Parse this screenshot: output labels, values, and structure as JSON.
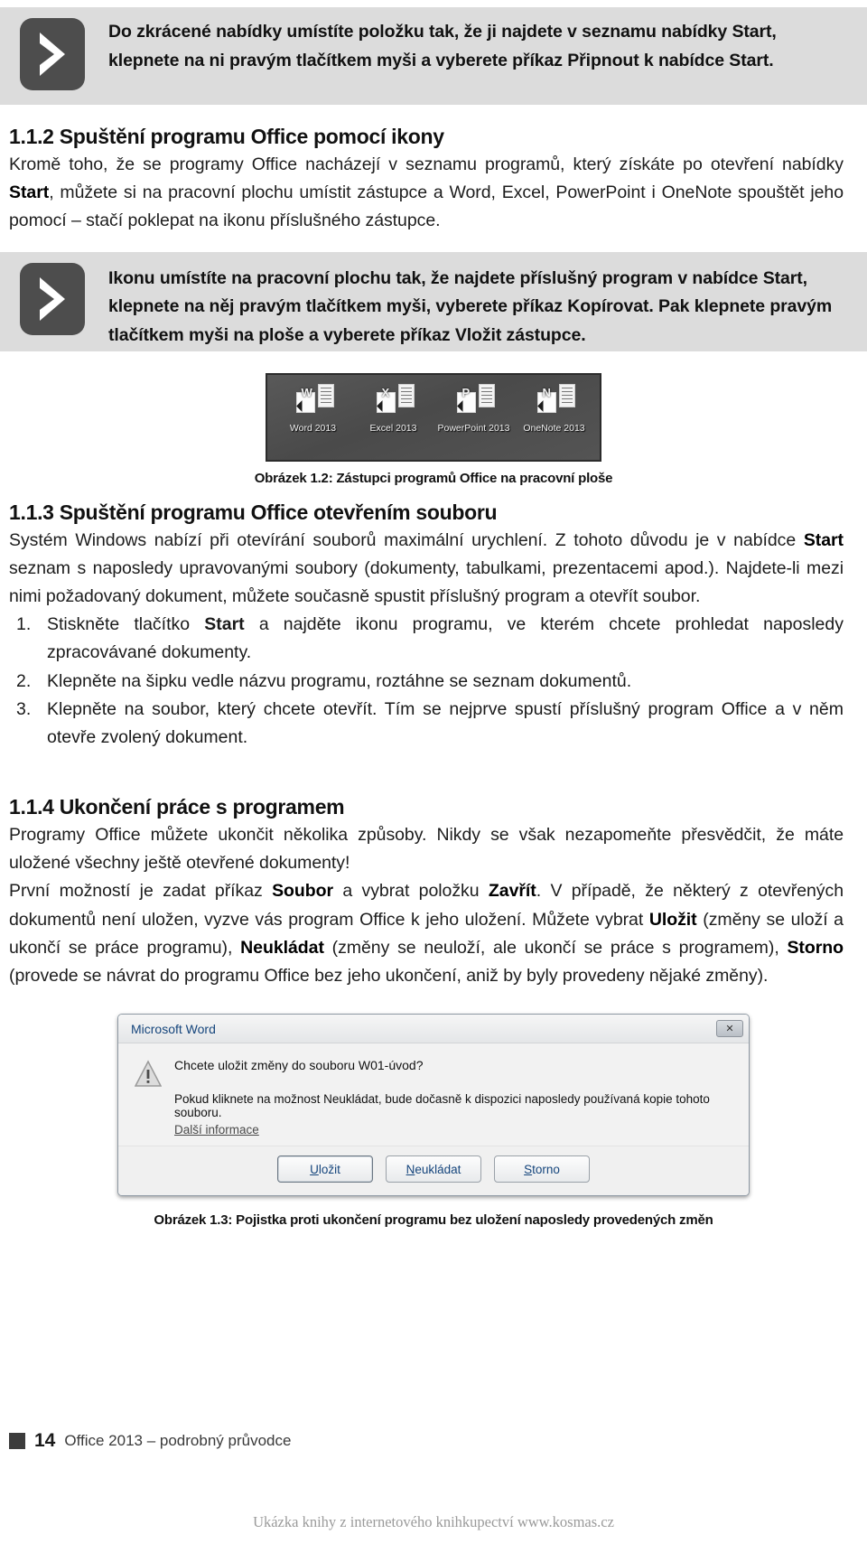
{
  "callouts": [
    {
      "icon": "chevron-right-icon",
      "parts": [
        {
          "t": "Do zkrácené nabídky umístíte položku tak, že ji najdete v seznamu nabídky ",
          "b": false
        },
        {
          "t": "Start",
          "b": true
        },
        {
          "t": ", klepnete na ni pravým tlačítkem myši a vyberete příkaz ",
          "b": false
        },
        {
          "t": "Připnout k nabídce Start",
          "b": true
        },
        {
          "t": ".",
          "b": false
        }
      ]
    },
    {
      "icon": "chevron-right-icon",
      "parts": [
        {
          "t": "Ikonu umístíte na pracovní plochu tak, že najdete příslušný program v nabídce ",
          "b": false
        },
        {
          "t": "Start",
          "b": true
        },
        {
          "t": ", klepnete na něj pravým tlačítkem myši, vyberete příkaz ",
          "b": false
        },
        {
          "t": "Kopírovat",
          "b": true
        },
        {
          "t": ". Pak klepnete pravým tlačítkem myši na ploše a vyberete příkaz ",
          "b": false
        },
        {
          "t": "Vložit zástupce",
          "b": true
        },
        {
          "t": ".",
          "b": false
        }
      ]
    }
  ],
  "section_112": {
    "heading": "1.1.2 Spuštění programu Office pomocí ikony",
    "paragraph": [
      {
        "t": "Kromě toho, že se programy Office nacházejí v seznamu programů, který získáte po otevření nabídky ",
        "b": false
      },
      {
        "t": "Start",
        "b": true
      },
      {
        "t": ", můžete si na pracovní plochu umístit zástupce a Word, Excel, PowerPoint i OneNote spouštět jeho pomocí – stačí poklepat na ikonu příslušného zástupce.",
        "b": false
      }
    ]
  },
  "figure_12": {
    "caption": "Obrázek 1.2: Zástupci programů Office na pracovní ploše",
    "icons": [
      {
        "letter": "W",
        "label": "Word 2013"
      },
      {
        "letter": "X",
        "label": "Excel 2013"
      },
      {
        "letter": "P",
        "label": "PowerPoint 2013"
      },
      {
        "letter": "N",
        "label": "OneNote 2013"
      }
    ]
  },
  "section_113": {
    "heading": "1.1.3 Spuštění programu Office otevřením souboru",
    "paragraph": [
      {
        "t": "Systém Windows nabízí při otevírání souborů maximální urychlení. Z tohoto důvodu je v nabídce ",
        "b": false
      },
      {
        "t": "Start",
        "b": true
      },
      {
        "t": " seznam s naposledy upravovanými soubory (dokumenty, tabulkami, prezentacemi apod.). Najdete-li mezi nimi požadovaný dokument, můžete současně spustit příslušný program a otevřít soubor.",
        "b": false
      }
    ],
    "steps": [
      [
        {
          "t": "Stiskněte tlačítko ",
          "b": false
        },
        {
          "t": "Start",
          "b": true
        },
        {
          "t": " a najděte ikonu programu, ve kterém chcete prohledat naposledy zpracovávané dokumenty.",
          "b": false
        }
      ],
      [
        {
          "t": "Klepněte na šipku vedle názvu programu, roztáhne se seznam dokumentů.",
          "b": false
        }
      ],
      [
        {
          "t": "Klepněte na soubor, který chcete otevřít. Tím se nejprve spustí příslušný program Office a v něm otevře zvolený dokument.",
          "b": false
        }
      ]
    ]
  },
  "section_114": {
    "heading": "1.1.4 Ukončení práce s programem",
    "paragraph1": [
      {
        "t": "Programy Office můžete ukončit několika způsoby. Nikdy se však nezapomeňte přesvědčit, že máte uložené všechny ještě otevřené dokumenty!",
        "b": false
      }
    ],
    "paragraph2": [
      {
        "t": "První možností je zadat příkaz ",
        "b": false
      },
      {
        "t": "Soubor",
        "b": true
      },
      {
        "t": " a vybrat položku ",
        "b": false
      },
      {
        "t": "Zavřít",
        "b": true
      },
      {
        "t": ". V případě, že některý z otevřených dokumentů není uložen, vyzve vás program Office k jeho uložení. Můžete vybrat ",
        "b": false
      },
      {
        "t": "Uložit",
        "b": true
      },
      {
        "t": " (změny se uloží a ukončí se práce programu), ",
        "b": false
      },
      {
        "t": "Neukládat",
        "b": true
      },
      {
        "t": " (změny se neuloží, ale ukončí se práce s programem), ",
        "b": false
      },
      {
        "t": "Storno",
        "b": true
      },
      {
        "t": " (provede se návrat do programu Office bez jeho ukončení, aniž by byly provedeny nějaké změny).",
        "b": false
      }
    ]
  },
  "dialog": {
    "title": "Microsoft Word",
    "close_label": "✕",
    "primary_message": "Chcete uložit změny do souboru W01-úvod?",
    "secondary_message": "Pokud kliknete na možnost Neukládat, bude dočasně k dispozici naposledy používaná kopie tohoto souboru.",
    "link_label": "Další informace",
    "buttons": [
      {
        "label": "Uložit",
        "accel": "U",
        "rest": "ložit"
      },
      {
        "label": "Neukládat",
        "accel": "N",
        "rest": "eukládat"
      },
      {
        "label": "Storno",
        "accel": "S",
        "rest": "torno"
      }
    ]
  },
  "figure_13": {
    "caption": "Obrázek 1.3: Pojistka proti ukončení programu bez uložení naposledy provedených změn"
  },
  "footer": {
    "page_number": "14",
    "book_title": "Office 2013 – podrobný průvodce",
    "watermark": "Ukázka knihy z internetového knihkupectví www.kosmas.cz"
  },
  "colors": {
    "callout_bg": "#dcdcdc",
    "badge_bg": "#4d4d4d",
    "desktop_bg": "#4f4f4f",
    "dialog_bg": "#f0f0f0",
    "dialog_title_text": "#15457c",
    "watermark_text": "#9a9a9a"
  }
}
